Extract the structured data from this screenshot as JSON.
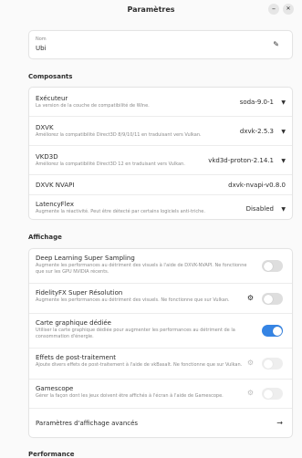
{
  "window": {
    "title": "Paramètres",
    "minimize": "–",
    "close": "✕"
  },
  "name_card": {
    "label": "Nom",
    "value": "Ubi"
  },
  "components": {
    "title": "Composants",
    "rows": [
      {
        "title": "Exécuteur",
        "subtitle": "La version de la couche de compatibilité de Wine.",
        "value": "soda-9.0-1"
      },
      {
        "title": "DXVK",
        "subtitle": "Améliorez la compatibilité Direct3D 8/9/10/11 en traduisant vers Vulkan.",
        "value": "dxvk-2.5.3"
      },
      {
        "title": "VKD3D",
        "subtitle": "Améliorez la compatibilité Direct3D 12 en traduisant vers Vulkan.",
        "value": "vkd3d-proton-2.14.1"
      },
      {
        "title": "DXVK NVAPI",
        "subtitle": "",
        "value": "dxvk-nvapi-v0.8.0"
      },
      {
        "title": "LatencyFlex",
        "subtitle": "Augmente la réactivité. Peut être détecté par certains logiciels anti-triche.",
        "value": "Disabled"
      }
    ]
  },
  "display": {
    "title": "Affichage",
    "rows": [
      {
        "title": "Deep Learning Super Sampling",
        "subtitle": "Augmente les performances au détriment des visuels à l'aide de DXVK-NVAPI. Ne fonctionne que sur les GPU NVIDIA récents.",
        "toggle": false,
        "gear": false,
        "disabled": false
      },
      {
        "title": "FidelityFX Super Résolution",
        "subtitle": "Augmente les performances au détriment des visuels. Ne fonctionne que sur Vulkan.",
        "toggle": false,
        "gear": true,
        "disabled": false
      },
      {
        "title": "Carte graphique dédiée",
        "subtitle": "Utiliser la carte graphique dédiée pour augmenter les performances au détriment de la consommation d'énergie.",
        "toggle": true,
        "gear": false,
        "disabled": false
      },
      {
        "title": "Effets de post-traitement",
        "subtitle": "Ajoute divers effets de post-traitement à l'aide de vkBasalt. Ne fonctionne que sur Vulkan.",
        "toggle": false,
        "gear": true,
        "disabled": true
      },
      {
        "title": "Gamescope",
        "subtitle": "Gérer la façon dont les jeux doivent être affichés à l'écran à l'aide de Gamescope.",
        "toggle": false,
        "gear": true,
        "disabled": true
      },
      {
        "title": "Paramètres d'affichage avancés",
        "subtitle": "",
        "arrow": "→"
      }
    ]
  },
  "performance": {
    "title": "Performance"
  },
  "icons": {
    "edit": "pencil-icon",
    "dropdown": "chevron-down-icon",
    "settings": "gear-icon",
    "arrow": "arrow-right-icon"
  },
  "colors": {
    "accent": "#3584e4",
    "toggle_off": "#dedede",
    "background": "#fafafa"
  }
}
